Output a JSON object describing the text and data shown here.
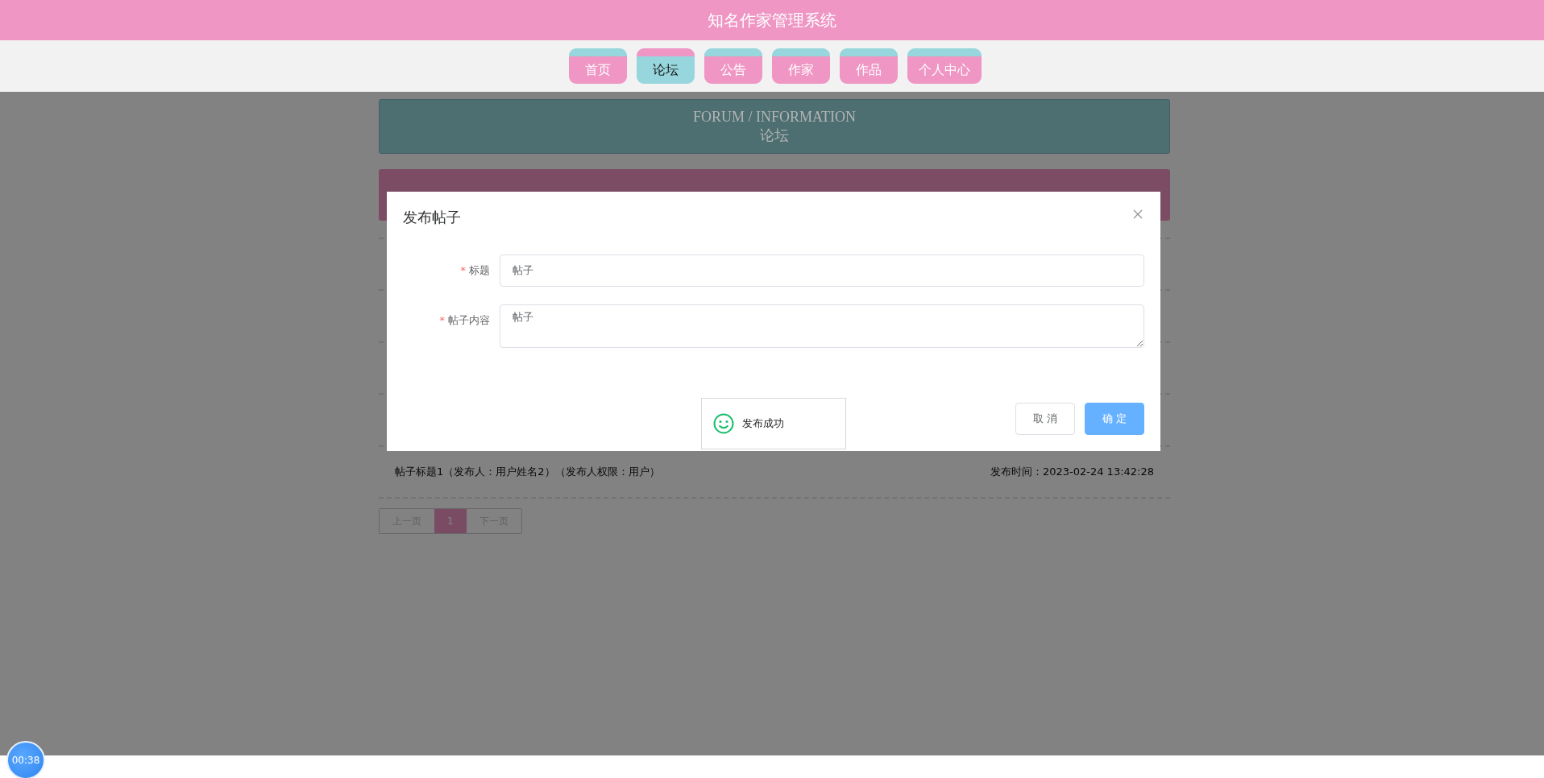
{
  "header": {
    "title": "知名作家管理系统"
  },
  "nav": [
    {
      "label": "首页",
      "selected": false
    },
    {
      "label": "论坛",
      "selected": true
    },
    {
      "label": "公告",
      "selected": false
    },
    {
      "label": "作家",
      "selected": false
    },
    {
      "label": "作品",
      "selected": false
    },
    {
      "label": "个人中心",
      "selected": false
    }
  ],
  "banner": {
    "title": "FORUM / INFORMATION",
    "subtitle": "论坛"
  },
  "posts": [
    {
      "title": "帖子标题1（发布人：用户姓名2）（发布人权限：用户）",
      "time": "发布时间：2023-02-24 13:42:28"
    }
  ],
  "pagination": {
    "prev": "上一页",
    "pages": [
      {
        "label": "1",
        "selected": true
      }
    ],
    "next": "下一页"
  },
  "dialog": {
    "title": "发布帖子",
    "fields": [
      {
        "label": "标题",
        "required_mark": "*",
        "kind": "input",
        "value": "帖子"
      },
      {
        "label": "帖子内容",
        "required_mark": "*",
        "kind": "textarea",
        "value": "帖子"
      }
    ],
    "buttons": [
      {
        "label": "取 消",
        "kind": "default"
      },
      {
        "label": "确 定",
        "kind": "primary"
      }
    ]
  },
  "toast": {
    "message": "发布成功"
  },
  "timer": {
    "time": "00:38"
  }
}
